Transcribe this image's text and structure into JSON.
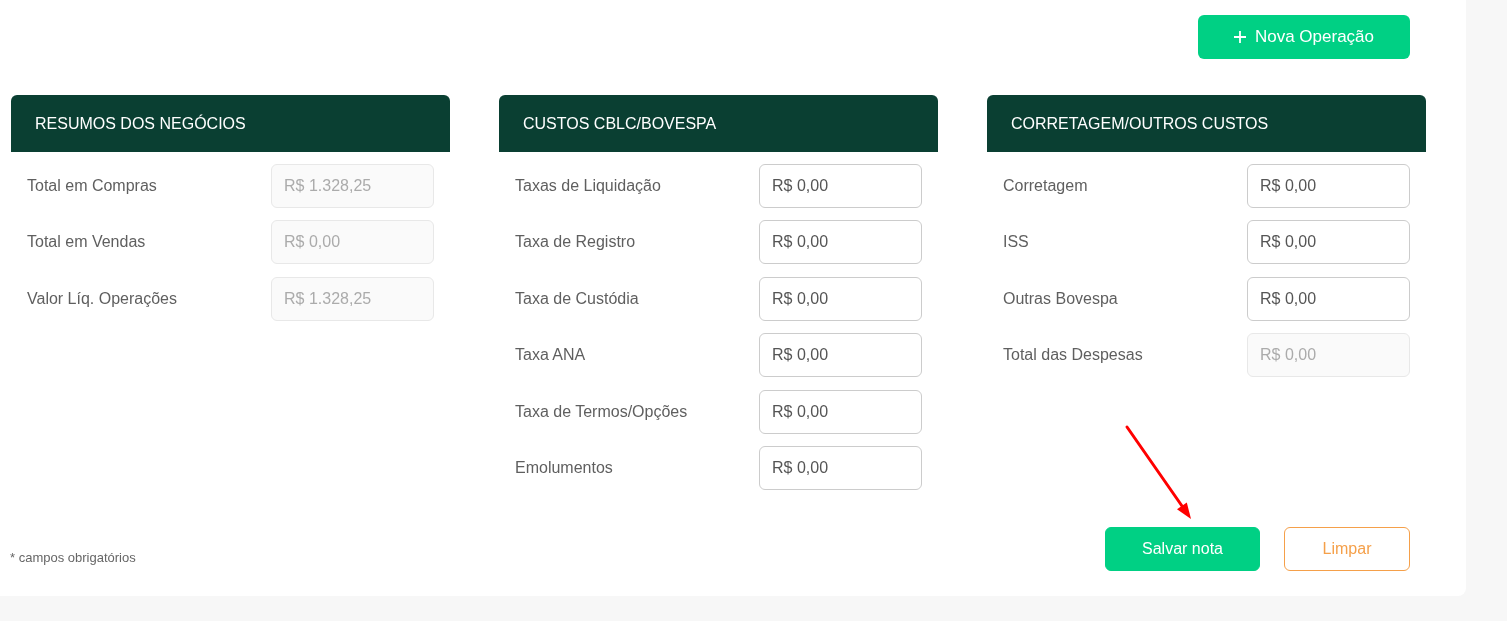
{
  "new_operation_button": {
    "label": "Nova Operação"
  },
  "panels": [
    {
      "title": "RESUMOS DOS NEGÓCIOS",
      "rows": [
        {
          "label": "Total em Compras",
          "value": "R$ 1.328,25",
          "disabled": true
        },
        {
          "label": "Total em Vendas",
          "value": "R$ 0,00",
          "disabled": true
        },
        {
          "label": "Valor Líq. Operações",
          "value": "R$ 1.328,25",
          "disabled": true
        }
      ]
    },
    {
      "title": "CUSTOS CBLC/BOVESPA",
      "rows": [
        {
          "label": "Taxas de Liquidação",
          "value": "R$ 0,00",
          "disabled": false
        },
        {
          "label": "Taxa de Registro",
          "value": "R$ 0,00",
          "disabled": false
        },
        {
          "label": "Taxa de Custódia",
          "value": "R$ 0,00",
          "disabled": false
        },
        {
          "label": "Taxa ANA",
          "value": "R$ 0,00",
          "disabled": false
        },
        {
          "label": "Taxa de Termos/Opções",
          "value": "R$ 0,00",
          "disabled": false
        },
        {
          "label": "Emolumentos",
          "value": "R$ 0,00",
          "disabled": false
        }
      ]
    },
    {
      "title": "CORRETAGEM/OUTROS CUSTOS",
      "rows": [
        {
          "label": "Corretagem",
          "value": "R$ 0,00",
          "disabled": false
        },
        {
          "label": "ISS",
          "value": "R$ 0,00",
          "disabled": false
        },
        {
          "label": "Outras Bovespa",
          "value": "R$ 0,00",
          "disabled": false
        },
        {
          "label": "Total das Despesas",
          "value": "R$ 0,00",
          "disabled": true
        }
      ]
    }
  ],
  "footer": {
    "note": "* campos obrigatórios",
    "buttons": [
      {
        "label": "Salvar nota",
        "kind": "primary"
      },
      {
        "label": "Limpar",
        "kind": "outline"
      }
    ]
  }
}
